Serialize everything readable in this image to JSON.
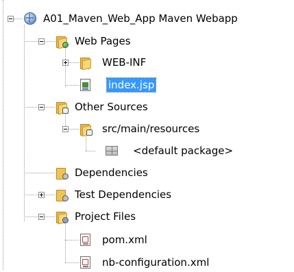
{
  "tree": {
    "root": {
      "label": "A01_Maven_Web_App Maven Webapp",
      "icon": "globe-icon",
      "expanded": true
    },
    "nodes": [
      {
        "id": "web-pages",
        "label": "Web Pages",
        "icon": "web-pages-folder-icon",
        "expanded": true
      },
      {
        "id": "web-inf",
        "label": "WEB-INF",
        "icon": "folder-icon",
        "expanded": false
      },
      {
        "id": "index-jsp",
        "label": "index.jsp",
        "icon": "jsp-file-icon",
        "selected": true
      },
      {
        "id": "other-sources",
        "label": "Other Sources",
        "icon": "source-folder-icon",
        "expanded": true
      },
      {
        "id": "src-main-resources",
        "label": "src/main/resources",
        "icon": "source-folder-icon",
        "expanded": true
      },
      {
        "id": "default-package",
        "label": "<default package>",
        "icon": "package-icon"
      },
      {
        "id": "dependencies",
        "label": "Dependencies",
        "icon": "library-folder-icon"
      },
      {
        "id": "test-dependencies",
        "label": "Test Dependencies",
        "icon": "library-folder-icon",
        "expanded": false
      },
      {
        "id": "project-files",
        "label": "Project Files",
        "icon": "settings-folder-icon",
        "expanded": true
      },
      {
        "id": "pom-xml",
        "label": "pom.xml",
        "icon": "xml-file-icon"
      },
      {
        "id": "nb-configuration-xml",
        "label": "nb-configuration.xml",
        "icon": "xml-file-icon"
      }
    ]
  },
  "colors": {
    "selection_background": "#3399ff",
    "selection_text": "#ffffff",
    "connector_line": "#9a9a9a"
  }
}
